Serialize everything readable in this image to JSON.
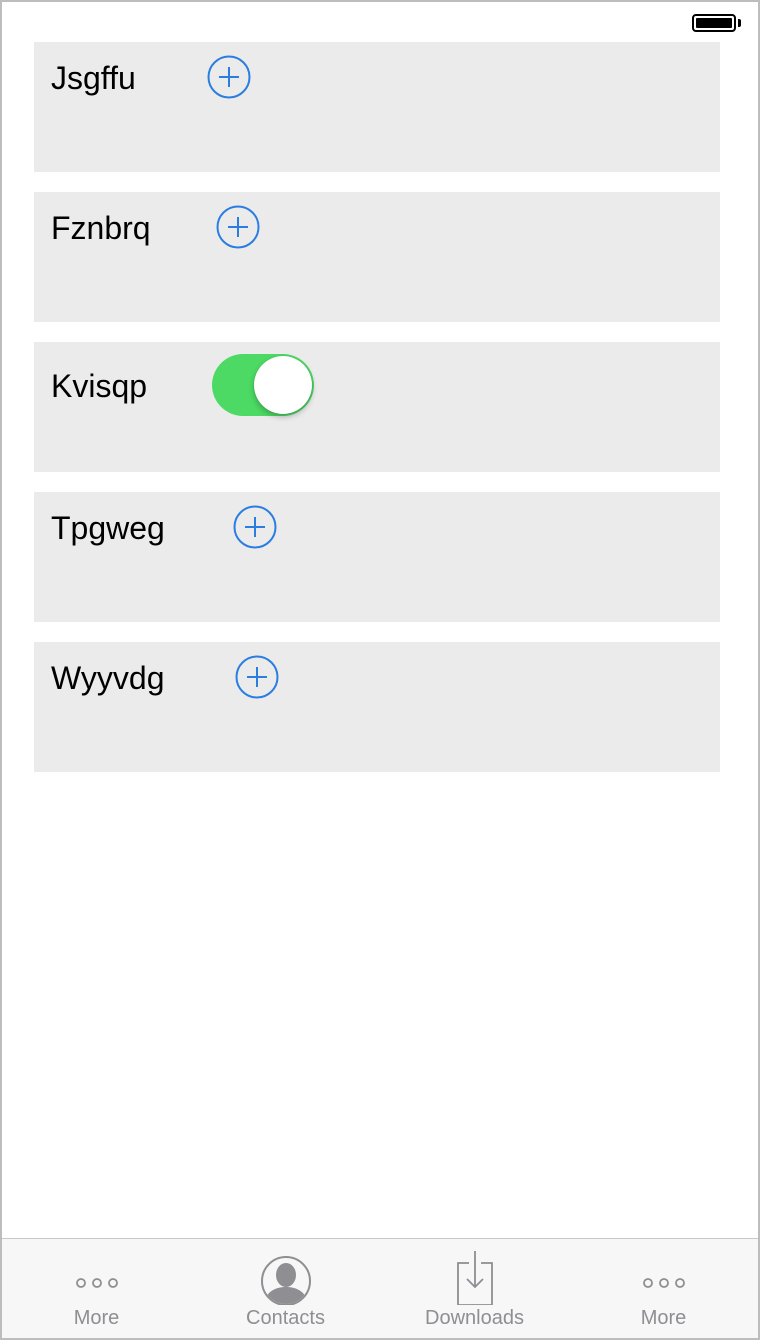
{
  "colors": {
    "accent": "#2a7de1",
    "toggle_on": "#4cd964",
    "row_bg": "#ebebeb",
    "tab_inactive": "#8e8e93"
  },
  "rows": [
    {
      "label": "Jsgffu",
      "control": "add"
    },
    {
      "label": "Fznbrq",
      "control": "add"
    },
    {
      "label": "Kvisqp",
      "control": "toggle",
      "toggle_on": true
    },
    {
      "label": "Tpgweg",
      "control": "add"
    },
    {
      "label": "Wyyvdg",
      "control": "add"
    }
  ],
  "tab_bar": {
    "tabs": [
      {
        "label": "More",
        "icon": "more-icon"
      },
      {
        "label": "Contacts",
        "icon": "contacts-icon"
      },
      {
        "label": "Downloads",
        "icon": "downloads-icon"
      },
      {
        "label": "More",
        "icon": "more-icon"
      }
    ]
  }
}
